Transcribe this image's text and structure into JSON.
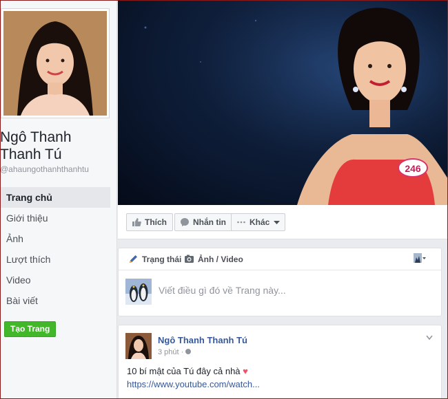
{
  "sidebar": {
    "name": "Ngô Thanh Thanh Tú",
    "handle": "@ahaungothanhthanhtu",
    "nav": [
      {
        "label": "Trang chủ",
        "active": true
      },
      {
        "label": "Giới thiệu",
        "active": false
      },
      {
        "label": "Ảnh",
        "active": false
      },
      {
        "label": "Lượt thích",
        "active": false
      },
      {
        "label": "Video",
        "active": false
      },
      {
        "label": "Bài viết",
        "active": false
      }
    ],
    "create_page_label": "Tạo Trang"
  },
  "cover": {
    "contestant_badge": "246"
  },
  "actions": {
    "like_label": "Thích",
    "message_label": "Nhắn tin",
    "more_label": "Khác"
  },
  "composer": {
    "tab_status": "Trạng thái",
    "tab_photo": "Ảnh / Video",
    "placeholder": "Viết điều gì đó về Trang này..."
  },
  "post": {
    "author": "Ngô Thanh Thanh Tú",
    "time": "3 phút",
    "text": "10 bí mật của Tú đây cả nhà",
    "link": "https://www.youtube.com/watch..."
  },
  "colors": {
    "accent": "#365899",
    "create_button": "#42b72a",
    "background": "#e9ebee"
  }
}
